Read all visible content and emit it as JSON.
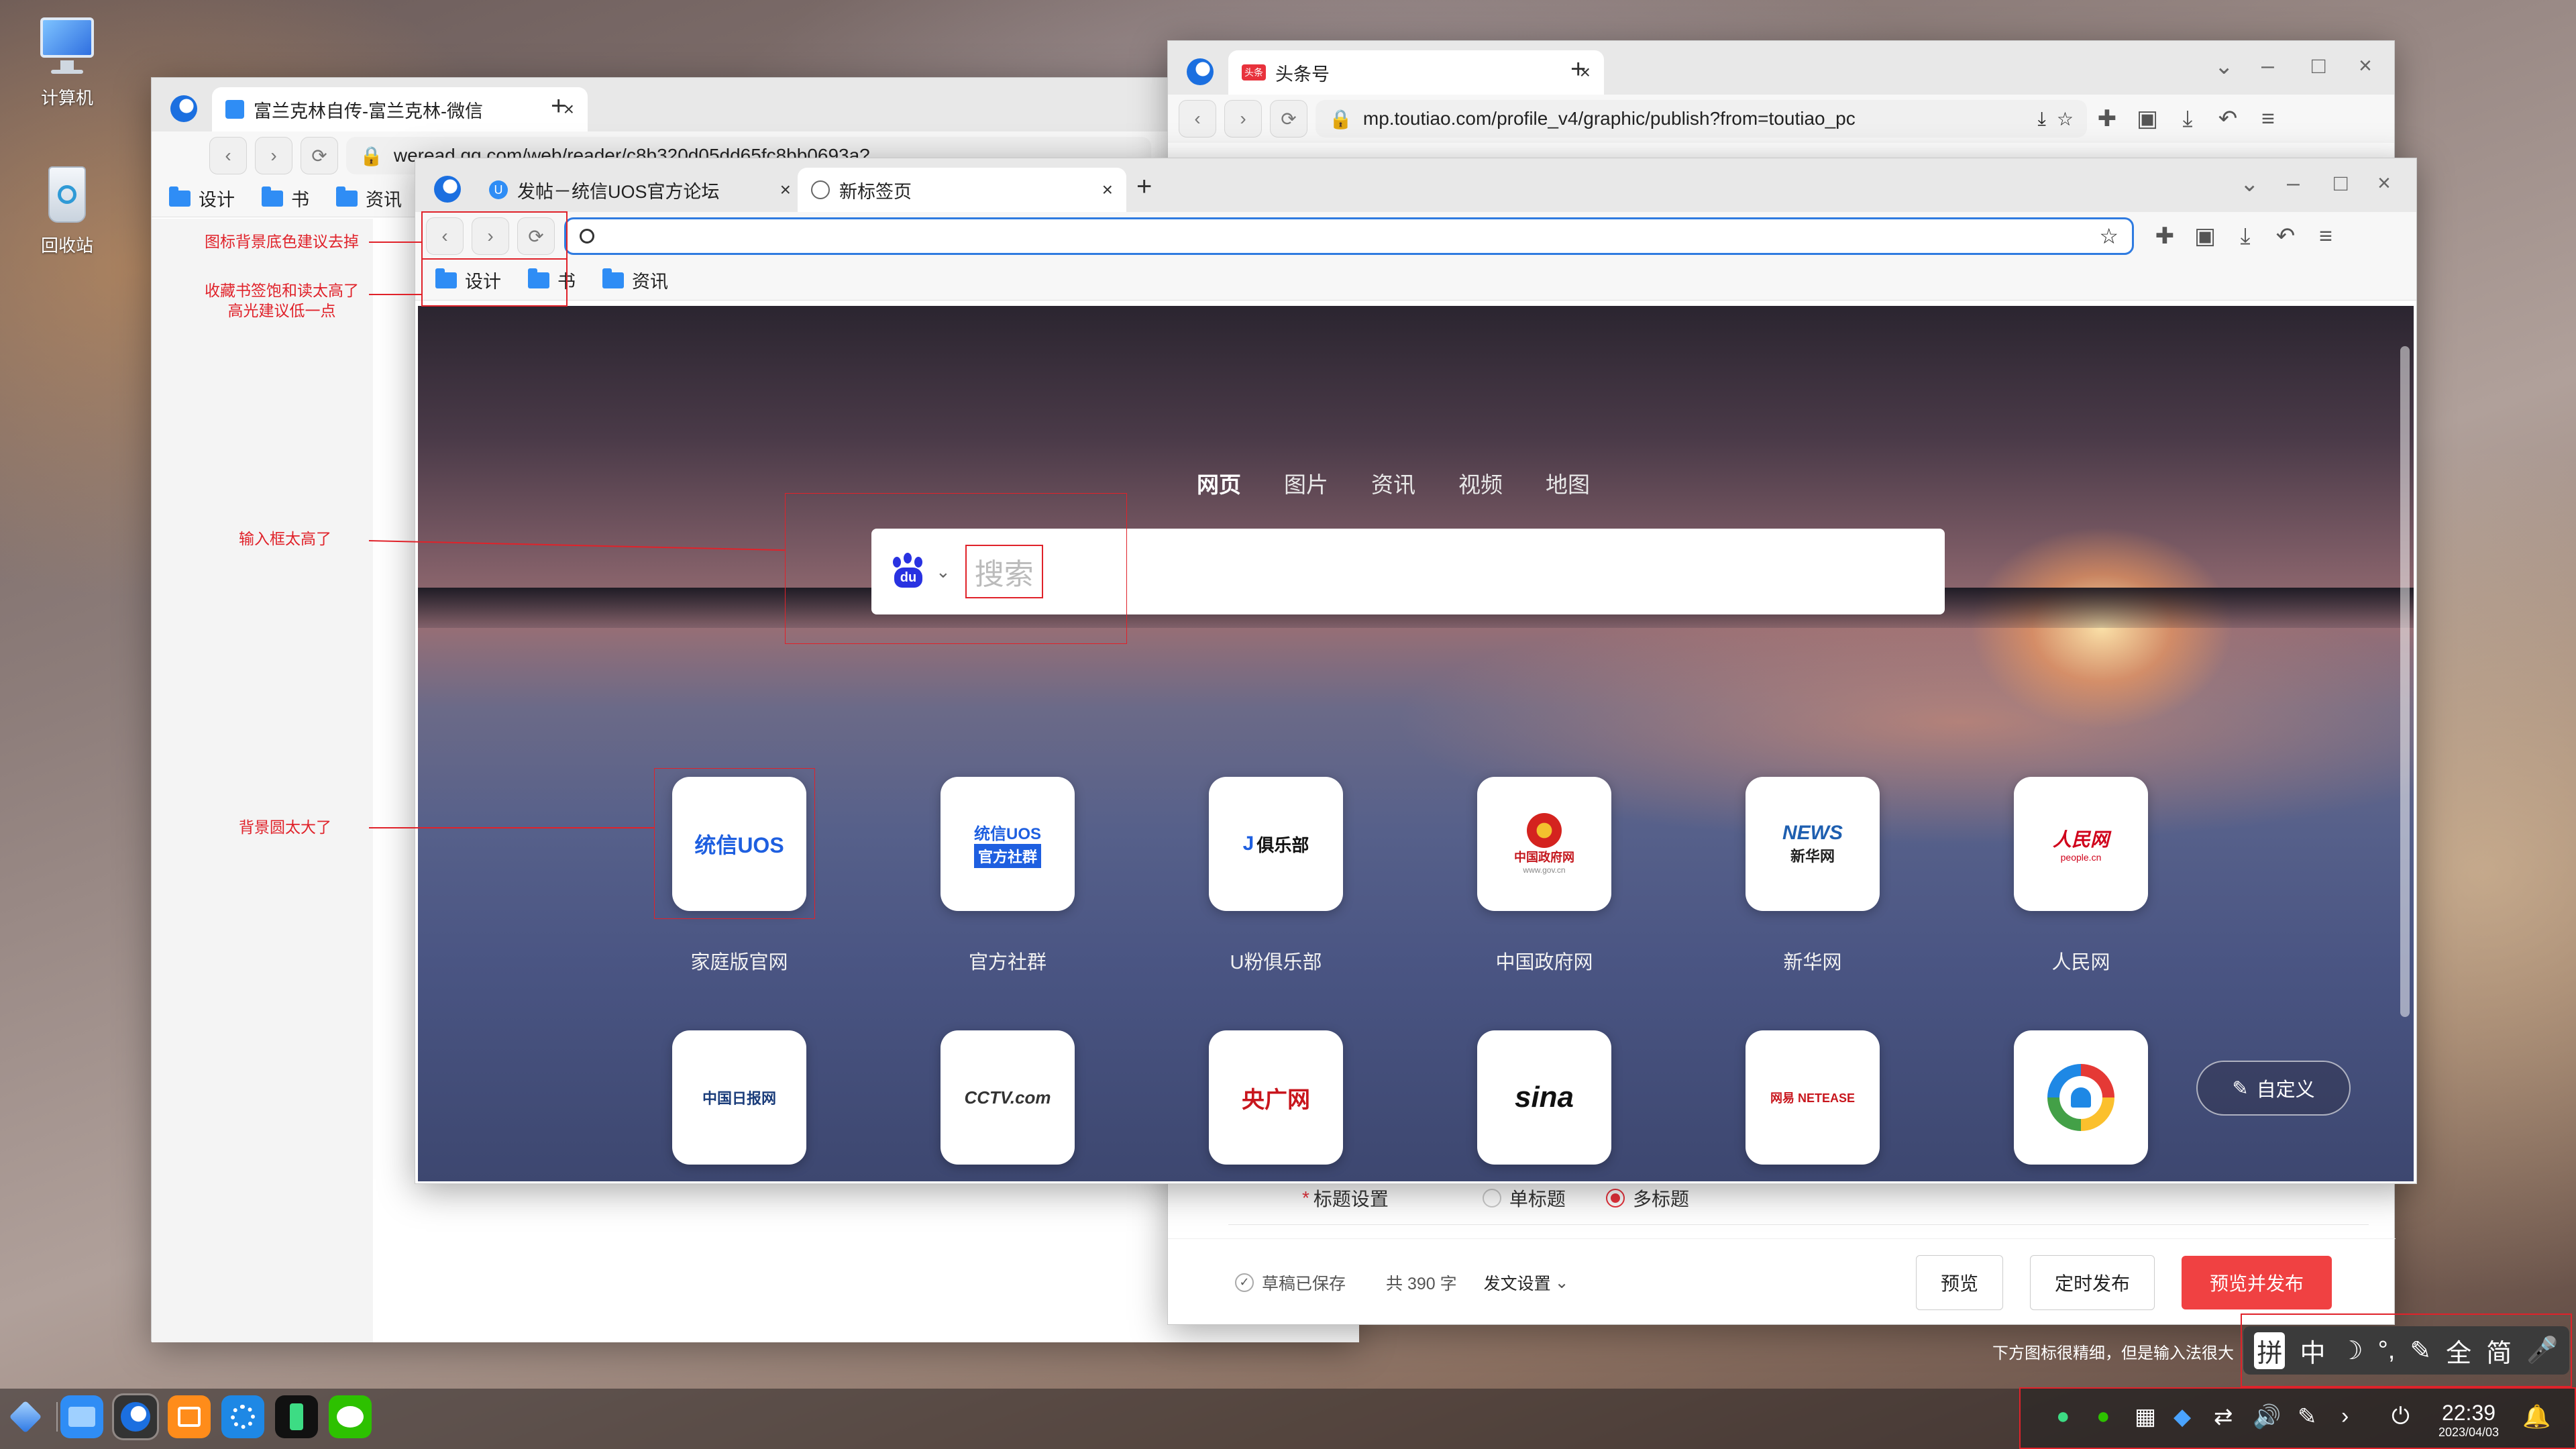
{
  "desktop": {
    "icons": [
      {
        "label": "计算机"
      },
      {
        "label": "回收站"
      }
    ]
  },
  "left_window": {
    "tab_title": "富兰克林自传-富兰克林-微信",
    "url": "weread.qq.com/web/reader/c8b320d05dd65fc8bb0693a?",
    "bookmarks": [
      "设计",
      "书",
      "资讯"
    ]
  },
  "right_window": {
    "tab_title": "头条号",
    "tab_badge": "头条",
    "url": "mp.toutiao.com/profile_v4/graphic/publish?from=toutiao_pc",
    "form": {
      "title_label": "标题设置",
      "required_mark": "*",
      "option_single": "单标题",
      "option_multi": "多标题"
    },
    "footer": {
      "saved": "草稿已保存",
      "count": "共 390 字",
      "settings": "发文设置",
      "preview": "预览",
      "schedule": "定时发布",
      "publish": "预览并发布"
    }
  },
  "main_window": {
    "tabs": [
      {
        "title": "发帖－统信UOS官方论坛"
      },
      {
        "title": "新标签页"
      }
    ],
    "bookmarks": [
      "设计",
      "书",
      "资讯"
    ],
    "search_tabs": [
      "网页",
      "图片",
      "资讯",
      "视频",
      "地图"
    ],
    "search_placeholder": "搜索",
    "search_engine_logo": "du",
    "customize": "自定义",
    "tiles": [
      {
        "label": "家庭版官网",
        "logo": "统信UOS"
      },
      {
        "label": "官方社群",
        "logo_top": "统信UOS",
        "logo_bottom": "官方社群"
      },
      {
        "label": "U粉俱乐部",
        "logo": "俱乐部"
      },
      {
        "label": "中国政府网",
        "logo": "中国政府网",
        "logo_sub": "www.gov.cn"
      },
      {
        "label": "新华网",
        "logo": "新华网",
        "logo_sub": "NEWS"
      },
      {
        "label": "人民网",
        "logo": "人民网",
        "logo_sub": "people.cn"
      },
      {
        "label": "",
        "logo": "中国日报网"
      },
      {
        "label": "",
        "logo": "CCTV.com"
      },
      {
        "label": "",
        "logo": "央广网"
      },
      {
        "label": "",
        "logo": "sina"
      },
      {
        "label": "",
        "logo": "网易 NETEASE"
      },
      {
        "label": "",
        "logo": ""
      }
    ]
  },
  "annotations": [
    "图标背景底色建议去掉",
    "收藏书签饱和读太高了\n高光建议低一点",
    "输入框太高了",
    "背景圆太大了",
    "下方图标很精细，但是输入法很大"
  ],
  "ime": [
    "拼",
    "中",
    "☽",
    "°,",
    "✎",
    "全",
    "简",
    "🎤"
  ],
  "taskbar": {
    "time": "22:39",
    "date": "2023/04/03"
  }
}
